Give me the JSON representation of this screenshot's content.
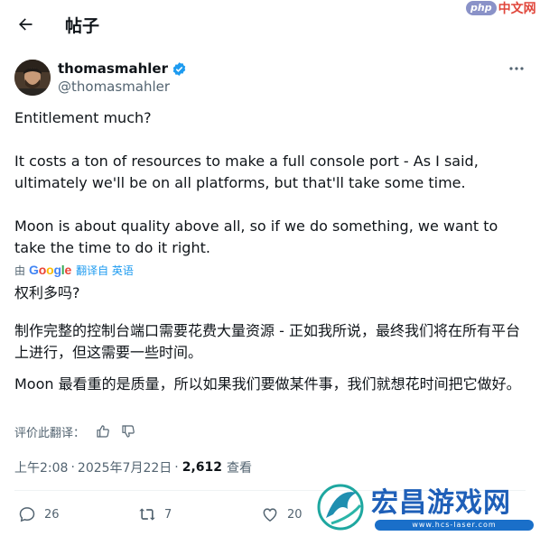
{
  "header": {
    "title": "帖子"
  },
  "watermark_php": {
    "badge": "php",
    "text": "中文网"
  },
  "author": {
    "name": "thomasmahler",
    "handle": "@thomasmahler"
  },
  "post": {
    "paragraphs": [
      "Entitlement much?",
      "It costs a ton of resources to make a full console port - As I said, ultimately we'll be on all platforms, but that'll take some time.",
      "Moon is about quality above all, so if we do something, we want to take the time to do it right."
    ]
  },
  "translation": {
    "by_prefix": "由",
    "provider": "Google",
    "link_text": "翻译自 英语",
    "paragraphs": [
      "权利多吗?",
      "制作完整的控制台端口需要花费大量资源 - 正如我所说，最终我们将在所有平台上进行，但这需要一些时间。",
      "Moon 最看重的是质量，所以如果我们要做某件事，我们就想花时间把它做好。"
    ],
    "rate_label": "评价此翻译："
  },
  "meta": {
    "time": "上午2:08",
    "separator": "·",
    "date": "2025年7月22日",
    "views_count": "2,612",
    "views_label": "查看"
  },
  "actions": {
    "replies": "26",
    "reposts": "7",
    "likes": "20"
  },
  "watermark_hcs": {
    "title": "宏昌游戏网",
    "url": "www.hcs-laser.com"
  },
  "colors": {
    "text": "#0f1419",
    "secondary": "#536471",
    "accent": "#1d9bf0",
    "divider": "#eff3f4"
  },
  "icons": [
    "back-arrow-icon",
    "verified-badge-icon",
    "more-icon",
    "google-logo",
    "thumbs-up-icon",
    "thumbs-down-icon",
    "reply-icon",
    "repost-icon",
    "like-icon"
  ]
}
